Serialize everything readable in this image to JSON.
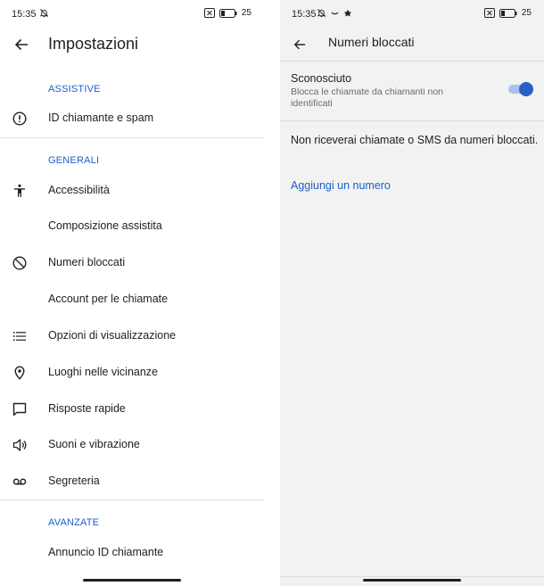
{
  "left": {
    "status": {
      "time": "15:35",
      "battery_text": "25"
    },
    "title": "Impostazioni",
    "sections": [
      {
        "header": "ASSISTIVE",
        "items": [
          {
            "label": "ID chiamante e spam",
            "icon": "alert-circle-icon"
          }
        ]
      },
      {
        "header": "GENERALI",
        "items": [
          {
            "label": "Accessibilità",
            "icon": "accessibility-icon"
          },
          {
            "label": "Composizione assistita",
            "icon": ""
          },
          {
            "label": "Numeri bloccati",
            "icon": "block-icon"
          },
          {
            "label": "Account per le chiamate",
            "icon": ""
          },
          {
            "label": "Opzioni di visualizzazione",
            "icon": "list-icon"
          },
          {
            "label": "Luoghi nelle vicinanze",
            "icon": "location-pin-icon"
          },
          {
            "label": "Risposte rapide",
            "icon": "chat-bubble-icon"
          },
          {
            "label": "Suoni e vibrazione",
            "icon": "speaker-icon"
          },
          {
            "label": "Segreteria",
            "icon": "voicemail-icon"
          }
        ]
      },
      {
        "header": "AVANZATE",
        "items": [
          {
            "label": "Annuncio ID chiamante",
            "icon": ""
          }
        ]
      }
    ]
  },
  "right": {
    "status": {
      "time": "15:35",
      "battery_text": "25"
    },
    "title": "Numeri bloccati",
    "unknown": {
      "title": "Sconosciuto",
      "summary": "Blocca le chiamate da chiamanti non identificati",
      "enabled": true
    },
    "info": "Non riceverai chiamate o SMS da numeri bloccati.",
    "add_link": "Aggiungi un numero"
  },
  "colors": {
    "accent": "#1a5fc8",
    "toggle_thumb": "#2b5fc8",
    "toggle_track": "#a8c1ee",
    "right_bg": "#f2f2f2"
  }
}
